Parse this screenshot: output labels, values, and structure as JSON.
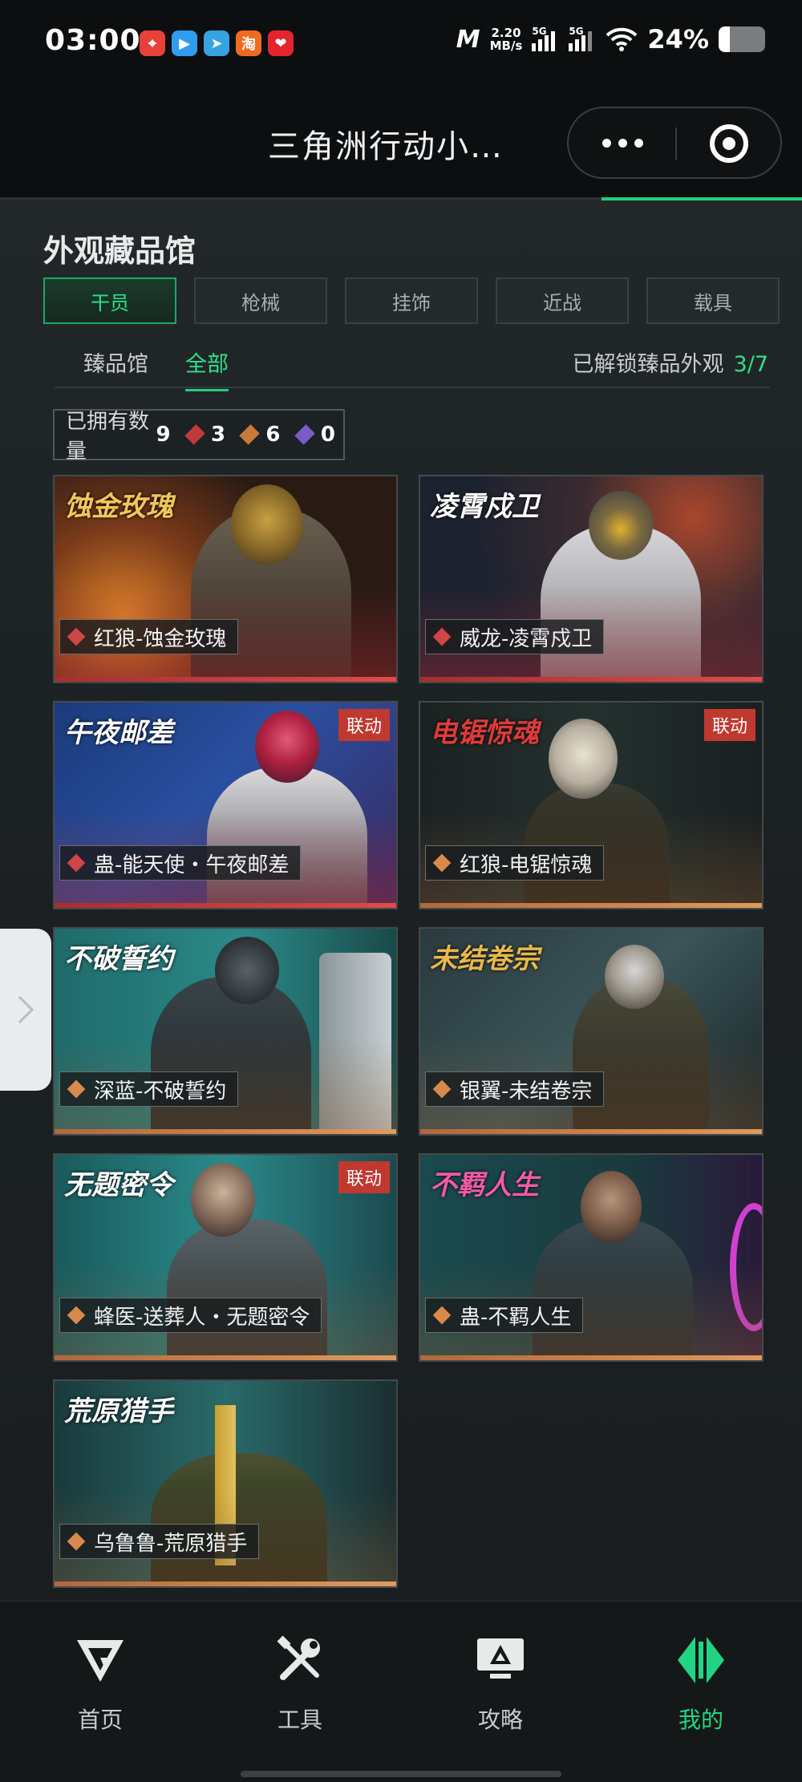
{
  "status_bar": {
    "time": "03:00",
    "apps": [
      {
        "icon": "maps-icon",
        "color": "#e8413a",
        "glyph": "⌖"
      },
      {
        "icon": "video-icon",
        "color": "#2f9cf0",
        "glyph": "▶"
      },
      {
        "icon": "telegram-icon",
        "color": "#36a3e0",
        "glyph": "➤"
      },
      {
        "icon": "taobao-icon",
        "color": "#f06a1f",
        "glyph": "淘"
      },
      {
        "icon": "heart-app-icon",
        "color": "#e5252d",
        "glyph": "❤"
      }
    ],
    "network_logo": "M",
    "speed_value": "2.20",
    "speed_unit": "MB/s",
    "signal_1": "5G",
    "signal_2": "5G",
    "battery_pct": "24%",
    "battery_level": 0.24
  },
  "header": {
    "title": "三角洲行动小…"
  },
  "collection": {
    "title": "外观藏品馆",
    "category_tabs": [
      "干员",
      "枪械",
      "挂饰",
      "近战",
      "载具"
    ],
    "active_category": 0,
    "sub_tabs": [
      "臻品馆",
      "全部"
    ],
    "active_sub_tab": 1,
    "unlock_label": "已解锁臻品外观",
    "unlock_count": "3/7",
    "owned_label": "已拥有数量",
    "owned_total": "9",
    "owned_red": "3",
    "owned_gold": "6",
    "owned_purple": "0"
  },
  "skins": [
    {
      "logo": "蚀金玫瑰",
      "name": "红狼-蚀金玫瑰",
      "rarity": "red",
      "tag": ""
    },
    {
      "logo": "凌霄戍卫",
      "name": "威龙-凌霄戍卫",
      "rarity": "red",
      "tag": ""
    },
    {
      "logo": "午夜邮差",
      "name": "蛊-能天使・午夜邮差",
      "rarity": "red",
      "tag": "联动"
    },
    {
      "logo": "电锯惊魂",
      "name": "红狼-电锯惊魂",
      "rarity": "gold",
      "tag": "联动"
    },
    {
      "logo": "不破誓约",
      "name": "深蓝-不破誓约",
      "rarity": "gold",
      "tag": ""
    },
    {
      "logo": "未结卷宗",
      "name": "银翼-未结卷宗",
      "rarity": "gold",
      "tag": ""
    },
    {
      "logo": "无题密令",
      "name": "蜂医-送葬人・无题密令",
      "rarity": "gold",
      "tag": "联动"
    },
    {
      "logo": "不羁人生",
      "name": "蛊-不羁人生",
      "rarity": "gold",
      "tag": ""
    },
    {
      "logo": "荒原猎手",
      "name": "乌鲁鲁-荒原猎手",
      "rarity": "gold",
      "tag": ""
    }
  ],
  "bottom_nav": [
    {
      "label": "首页",
      "icon": "home-g-icon"
    },
    {
      "label": "工具",
      "icon": "tools-icon"
    },
    {
      "label": "攻略",
      "icon": "guide-monitor-icon"
    },
    {
      "label": "我的",
      "icon": "profile-logo-icon"
    }
  ],
  "active_nav": 3,
  "colors": {
    "accent_green": "#1fd17c",
    "rarity_red": "#d04545",
    "rarity_gold": "#d88a4c",
    "rarity_purple": "#7a5cc9",
    "tag_red": "#c0392f"
  }
}
